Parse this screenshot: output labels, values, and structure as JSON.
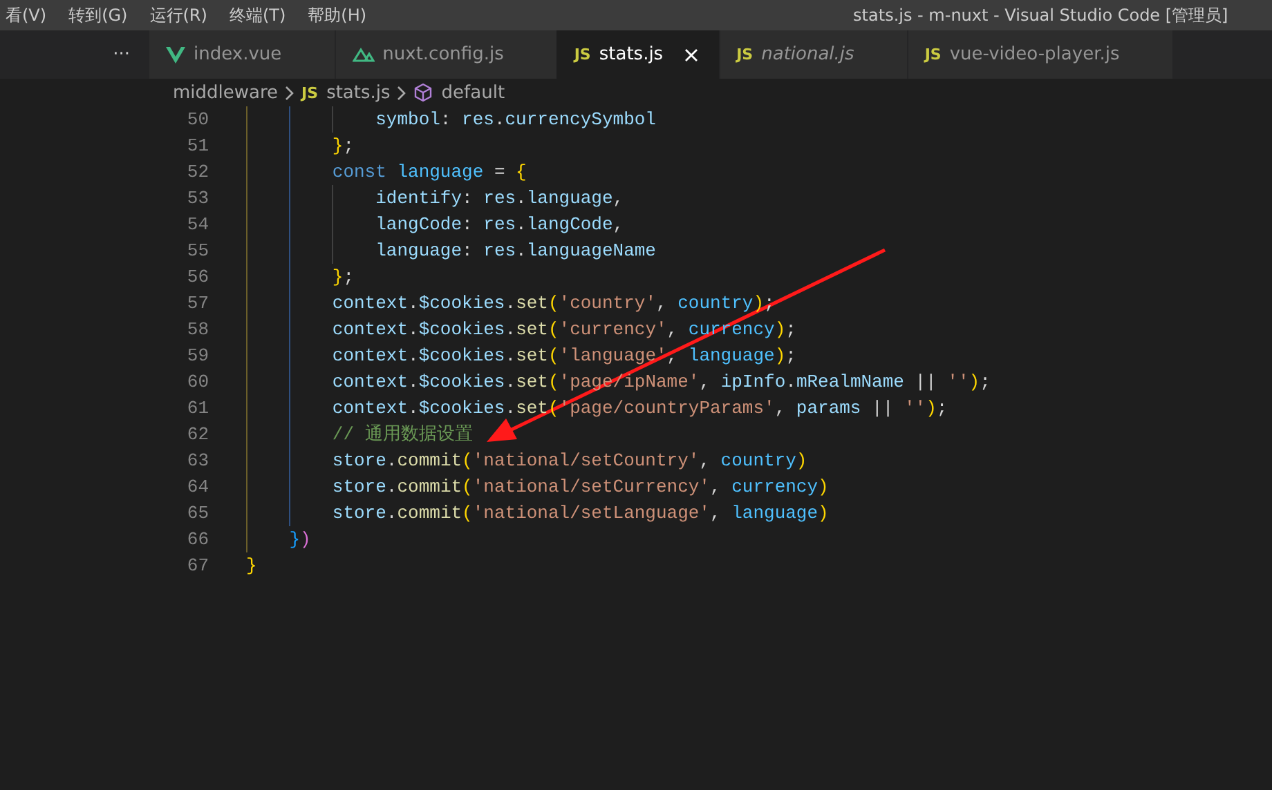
{
  "menu": [
    "看(V)",
    "转到(G)",
    "运行(R)",
    "终端(T)",
    "帮助(H)"
  ],
  "window": {
    "title": "stats.js - m-nuxt - Visual Studio Code [管理员]"
  },
  "sidebar": {
    "more": "···"
  },
  "tabs": [
    {
      "label": "index.vue",
      "kind": "vue",
      "selected": false,
      "preview": false
    },
    {
      "label": "nuxt.config.js",
      "kind": "nuxt",
      "selected": false,
      "preview": false
    },
    {
      "label": "stats.js",
      "kind": "js",
      "badge": "JS",
      "selected": true,
      "preview": false
    },
    {
      "label": "national.js",
      "kind": "js",
      "badge": "JS",
      "selected": false,
      "preview": true
    },
    {
      "label": "vue-video-player.js",
      "kind": "js",
      "badge": "JS",
      "selected": false,
      "preview": false
    }
  ],
  "breadcrumbs": [
    {
      "label": "middleware",
      "kind": "folder"
    },
    {
      "label": "stats.js",
      "kind": "js",
      "badge": "JS"
    },
    {
      "label": "default",
      "kind": "symbol"
    }
  ],
  "editor": {
    "lines": [
      {
        "number": "50",
        "tokens": [
          {
            "kind": "prop",
            "text": "            symbol"
          },
          {
            "kind": "plain",
            "text": ": "
          },
          {
            "kind": "var",
            "text": "res"
          },
          {
            "kind": "plain",
            "text": "."
          },
          {
            "kind": "prop",
            "text": "currencySymbol"
          }
        ]
      },
      {
        "number": "51",
        "tokens": [
          {
            "kind": "brace",
            "text": "        }"
          },
          {
            "kind": "plain",
            "text": ";"
          }
        ]
      },
      {
        "number": "52",
        "tokens": [
          {
            "kind": "keyword",
            "text": "        const "
          },
          {
            "kind": "const",
            "text": "language"
          },
          {
            "kind": "plain",
            "text": " = "
          },
          {
            "kind": "brace",
            "text": "{"
          }
        ]
      },
      {
        "number": "53",
        "tokens": [
          {
            "kind": "prop",
            "text": "            identify"
          },
          {
            "kind": "plain",
            "text": ": "
          },
          {
            "kind": "var",
            "text": "res"
          },
          {
            "kind": "plain",
            "text": "."
          },
          {
            "kind": "prop",
            "text": "language"
          },
          {
            "kind": "plain",
            "text": ","
          }
        ]
      },
      {
        "number": "54",
        "tokens": [
          {
            "kind": "prop",
            "text": "            langCode"
          },
          {
            "kind": "plain",
            "text": ": "
          },
          {
            "kind": "var",
            "text": "res"
          },
          {
            "kind": "plain",
            "text": "."
          },
          {
            "kind": "prop",
            "text": "langCode"
          },
          {
            "kind": "plain",
            "text": ","
          }
        ]
      },
      {
        "number": "55",
        "tokens": [
          {
            "kind": "prop",
            "text": "            language"
          },
          {
            "kind": "plain",
            "text": ": "
          },
          {
            "kind": "var",
            "text": "res"
          },
          {
            "kind": "plain",
            "text": "."
          },
          {
            "kind": "prop",
            "text": "languageName"
          }
        ]
      },
      {
        "number": "56",
        "tokens": [
          {
            "kind": "brace",
            "text": "        }"
          },
          {
            "kind": "plain",
            "text": ";"
          }
        ]
      },
      {
        "number": "57",
        "tokens": [
          {
            "kind": "var",
            "text": "        context"
          },
          {
            "kind": "plain",
            "text": "."
          },
          {
            "kind": "var",
            "text": "$cookies"
          },
          {
            "kind": "plain",
            "text": "."
          },
          {
            "kind": "func",
            "text": "set"
          },
          {
            "kind": "brace",
            "text": "("
          },
          {
            "kind": "string",
            "text": "'country'"
          },
          {
            "kind": "plain",
            "text": ", "
          },
          {
            "kind": "const",
            "text": "country"
          },
          {
            "kind": "brace",
            "text": ")"
          },
          {
            "kind": "plain",
            "text": ";"
          }
        ]
      },
      {
        "number": "58",
        "tokens": [
          {
            "kind": "var",
            "text": "        context"
          },
          {
            "kind": "plain",
            "text": "."
          },
          {
            "kind": "var",
            "text": "$cookies"
          },
          {
            "kind": "plain",
            "text": "."
          },
          {
            "kind": "func",
            "text": "set"
          },
          {
            "kind": "brace",
            "text": "("
          },
          {
            "kind": "string",
            "text": "'currency'"
          },
          {
            "kind": "plain",
            "text": ", "
          },
          {
            "kind": "const",
            "text": "currency"
          },
          {
            "kind": "brace",
            "text": ")"
          },
          {
            "kind": "plain",
            "text": ";"
          }
        ]
      },
      {
        "number": "59",
        "tokens": [
          {
            "kind": "var",
            "text": "        context"
          },
          {
            "kind": "plain",
            "text": "."
          },
          {
            "kind": "var",
            "text": "$cookies"
          },
          {
            "kind": "plain",
            "text": "."
          },
          {
            "kind": "func",
            "text": "set"
          },
          {
            "kind": "brace",
            "text": "("
          },
          {
            "kind": "string",
            "text": "'language'"
          },
          {
            "kind": "plain",
            "text": ", "
          },
          {
            "kind": "const",
            "text": "language"
          },
          {
            "kind": "brace",
            "text": ")"
          },
          {
            "kind": "plain",
            "text": ";"
          }
        ]
      },
      {
        "number": "60",
        "tokens": [
          {
            "kind": "var",
            "text": "        context"
          },
          {
            "kind": "plain",
            "text": "."
          },
          {
            "kind": "var",
            "text": "$cookies"
          },
          {
            "kind": "plain",
            "text": "."
          },
          {
            "kind": "func",
            "text": "set"
          },
          {
            "kind": "brace",
            "text": "("
          },
          {
            "kind": "string",
            "text": "'page/ipName'"
          },
          {
            "kind": "plain",
            "text": ", "
          },
          {
            "kind": "var",
            "text": "ipInfo"
          },
          {
            "kind": "plain",
            "text": "."
          },
          {
            "kind": "var",
            "text": "mRealmName"
          },
          {
            "kind": "plain",
            "text": " || "
          },
          {
            "kind": "string",
            "text": "''"
          },
          {
            "kind": "brace",
            "text": ")"
          },
          {
            "kind": "plain",
            "text": ";"
          }
        ]
      },
      {
        "number": "61",
        "tokens": [
          {
            "kind": "var",
            "text": "        context"
          },
          {
            "kind": "plain",
            "text": "."
          },
          {
            "kind": "var",
            "text": "$cookies"
          },
          {
            "kind": "plain",
            "text": "."
          },
          {
            "kind": "func",
            "text": "set"
          },
          {
            "kind": "brace",
            "text": "("
          },
          {
            "kind": "string",
            "text": "'page/countryParams'"
          },
          {
            "kind": "plain",
            "text": ", "
          },
          {
            "kind": "var",
            "text": "params"
          },
          {
            "kind": "plain",
            "text": " || "
          },
          {
            "kind": "string",
            "text": "''"
          },
          {
            "kind": "brace",
            "text": ")"
          },
          {
            "kind": "plain",
            "text": ";"
          }
        ]
      },
      {
        "number": "62",
        "tokens": [
          {
            "kind": "comment",
            "text": "        // 通用数据设置"
          }
        ]
      },
      {
        "number": "63",
        "tokens": [
          {
            "kind": "var",
            "text": "        store"
          },
          {
            "kind": "plain",
            "text": "."
          },
          {
            "kind": "func",
            "text": "commit"
          },
          {
            "kind": "brace",
            "text": "("
          },
          {
            "kind": "string",
            "text": "'national/setCountry'"
          },
          {
            "kind": "plain",
            "text": ", "
          },
          {
            "kind": "const",
            "text": "country"
          },
          {
            "kind": "brace",
            "text": ")"
          }
        ]
      },
      {
        "number": "64",
        "tokens": [
          {
            "kind": "var",
            "text": "        store"
          },
          {
            "kind": "plain",
            "text": "."
          },
          {
            "kind": "func",
            "text": "commit"
          },
          {
            "kind": "brace",
            "text": "("
          },
          {
            "kind": "string",
            "text": "'national/setCurrency'"
          },
          {
            "kind": "plain",
            "text": ", "
          },
          {
            "kind": "const",
            "text": "currency"
          },
          {
            "kind": "brace",
            "text": ")"
          }
        ]
      },
      {
        "number": "65",
        "tokens": [
          {
            "kind": "var",
            "text": "        store"
          },
          {
            "kind": "plain",
            "text": "."
          },
          {
            "kind": "func",
            "text": "commit"
          },
          {
            "kind": "brace",
            "text": "("
          },
          {
            "kind": "string",
            "text": "'national/setLanguage'"
          },
          {
            "kind": "plain",
            "text": ", "
          },
          {
            "kind": "const",
            "text": "language"
          },
          {
            "kind": "brace",
            "text": ")"
          }
        ]
      },
      {
        "number": "66",
        "tokens": [
          {
            "kind": "brace2",
            "text": "    }"
          },
          {
            "kind": "brace3",
            "text": ")"
          }
        ]
      },
      {
        "number": "67",
        "tokens": [
          {
            "kind": "brace",
            "text": "}"
          }
        ]
      }
    ]
  },
  "annotation": {
    "kind": "arrow"
  }
}
